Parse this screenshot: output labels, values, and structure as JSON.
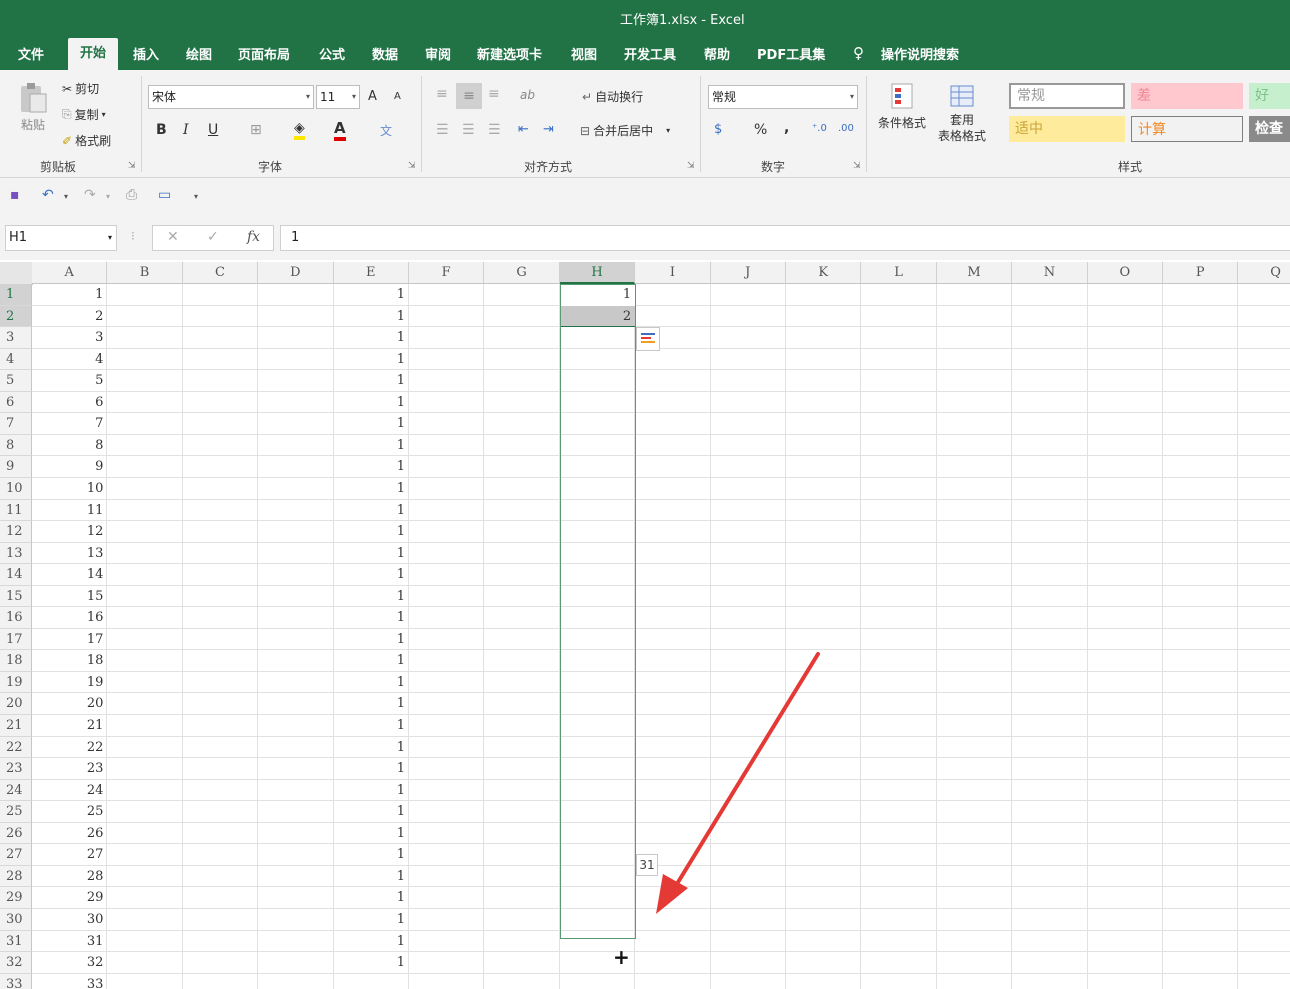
{
  "window": {
    "title": "工作簿1.xlsx  -  Excel"
  },
  "menu": [
    "文件",
    "开始",
    "插入",
    "绘图",
    "页面布局",
    "公式",
    "数据",
    "审阅",
    "新建选项卡",
    "视图",
    "开发工具",
    "帮助",
    "PDF工具集"
  ],
  "tell_me": "操作说明搜索",
  "clipboard": {
    "paste": "粘贴",
    "cut": "剪切",
    "copy": "复制",
    "format_painter": "格式刷",
    "label": "剪贴板"
  },
  "font": {
    "name": "宋体",
    "size": "11",
    "bold": "B",
    "italic": "I",
    "underline": "U",
    "label": "字体",
    "grow": "A",
    "shrink": "A",
    "color_a": "A",
    "wen": "文"
  },
  "alignment": {
    "wrap": "自动换行",
    "merge": "合并后居中",
    "label": "对齐方式",
    "orient": "ab"
  },
  "number": {
    "format": "常规",
    "percent": "%",
    "comma": ",",
    "inc": "⁺.0",
    "dec": ".00",
    "label": "数字"
  },
  "styles": {
    "conditional": "条件格式",
    "table_l1": "套用",
    "table_l2": "表格格式",
    "normal": "常规",
    "bad": "差",
    "good": "好",
    "neutral": "适中",
    "calc": "计算",
    "check": "检查",
    "label": "样式"
  },
  "formula_bar": {
    "name_box": "H1",
    "fx": "fx",
    "cancel": "✕",
    "enter": "✓",
    "value": "1"
  },
  "columns": [
    "A",
    "B",
    "C",
    "D",
    "E",
    "F",
    "G",
    "H",
    "I",
    "J",
    "K",
    "L",
    "M",
    "N",
    "O",
    "P",
    "Q"
  ],
  "rows": [
    "1",
    "2",
    "3",
    "4",
    "5",
    "6",
    "7",
    "8",
    "9",
    "10",
    "11",
    "12",
    "13",
    "14",
    "15",
    "16",
    "17",
    "18",
    "19",
    "20",
    "21",
    "22",
    "23",
    "24",
    "25",
    "26",
    "27",
    "28",
    "29",
    "30",
    "31",
    "32",
    "33"
  ],
  "col_a": [
    "1",
    "2",
    "3",
    "4",
    "5",
    "6",
    "7",
    "8",
    "9",
    "10",
    "11",
    "12",
    "13",
    "14",
    "15",
    "16",
    "17",
    "18",
    "19",
    "20",
    "21",
    "22",
    "23",
    "24",
    "25",
    "26",
    "27",
    "28",
    "29",
    "30",
    "31",
    "32",
    "33"
  ],
  "col_e": [
    "1",
    "1",
    "1",
    "1",
    "1",
    "1",
    "1",
    "1",
    "1",
    "1",
    "1",
    "1",
    "1",
    "1",
    "1",
    "1",
    "1",
    "1",
    "1",
    "1",
    "1",
    "1",
    "1",
    "1",
    "1",
    "1",
    "1",
    "1",
    "1",
    "1",
    "1",
    "1"
  ],
  "col_h": [
    "1",
    "2"
  ],
  "fill_tooltip": "31",
  "fill_cursor": "+",
  "colors": {
    "excel_green": "#217346",
    "arrow": "#e53935"
  }
}
